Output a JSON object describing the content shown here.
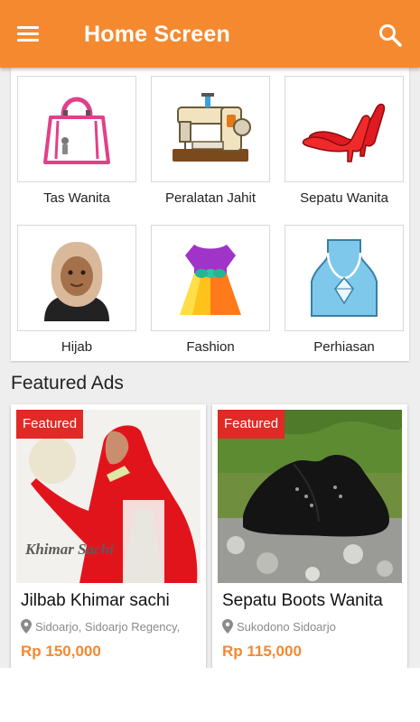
{
  "app_bar": {
    "title": "Home Screen",
    "menu_icon": "menu-icon",
    "search_icon": "search-icon",
    "color": "#f5892f"
  },
  "categories": [
    {
      "label": "Tas Wanita",
      "icon": "handbag-icon"
    },
    {
      "label": "Peralatan Jahit",
      "icon": "sewing-machine-icon"
    },
    {
      "label": "Sepatu Wanita",
      "icon": "high-heel-icon"
    },
    {
      "label": "Hijab",
      "icon": "hijab-woman-icon"
    },
    {
      "label": "Fashion",
      "icon": "dress-icon"
    },
    {
      "label": "Perhiasan",
      "icon": "necklace-icon"
    }
  ],
  "featured": {
    "title": "Featured Ads",
    "badge_color": "#e02a25",
    "price_color": "#f5892f",
    "ads": [
      {
        "badge": "Featured",
        "image_text": "Khimar Sachi",
        "title": "Jilbab Khimar sachi",
        "location": "Sidoarjo, Sidoarjo Regency,",
        "price": "Rp 150,000"
      },
      {
        "badge": "Featured",
        "title": "Sepatu Boots Wanita",
        "location": "Sukodono Sidoarjo",
        "price": "Rp 115,000"
      }
    ]
  }
}
